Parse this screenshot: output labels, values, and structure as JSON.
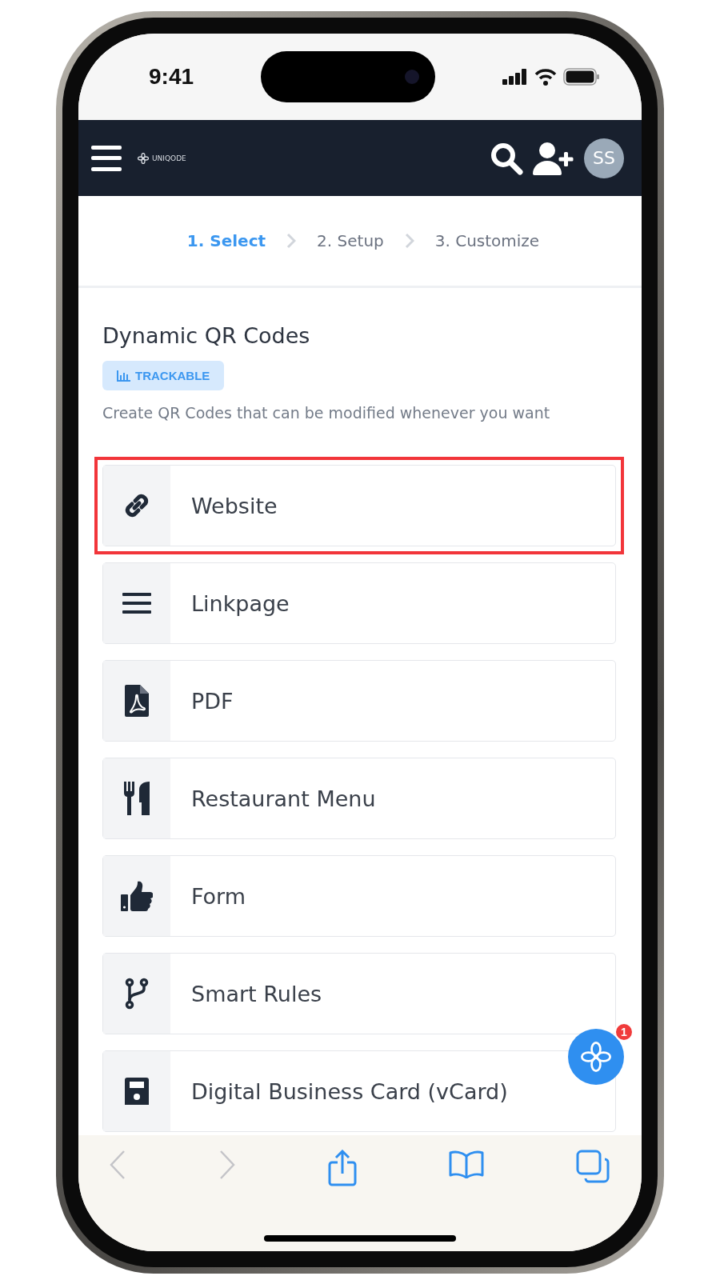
{
  "status_bar": {
    "time": "9:41"
  },
  "header": {
    "logo_text": "UNIQODE",
    "avatar": "SS"
  },
  "steps": [
    {
      "label": "1. Select",
      "selected": true
    },
    {
      "label": "2. Setup",
      "selected": false
    },
    {
      "label": "3. Customize",
      "selected": false
    }
  ],
  "section": {
    "title": "Dynamic QR Codes",
    "badge": "TRACKABLE",
    "description": "Create QR Codes that can be modified whenever you want"
  },
  "items": [
    {
      "kind": "link",
      "label": "Website",
      "selected": true
    },
    {
      "kind": "list",
      "label": "Linkpage",
      "selected": false
    },
    {
      "kind": "pdf",
      "label": "PDF",
      "selected": false
    },
    {
      "kind": "utensils",
      "label": "Restaurant Menu",
      "selected": false
    },
    {
      "kind": "thumb",
      "label": "Form",
      "selected": false
    },
    {
      "kind": "branch",
      "label": "Smart Rules",
      "selected": false
    },
    {
      "kind": "card",
      "label": "Digital Business Card (vCard)",
      "selected": false
    }
  ],
  "chat": {
    "badge": "1"
  },
  "browser_toolbar": [
    {
      "kind": "back",
      "disabled": true
    },
    {
      "kind": "forward",
      "disabled": true
    },
    {
      "kind": "share",
      "disabled": false
    },
    {
      "kind": "bookmarks",
      "disabled": false
    },
    {
      "kind": "tabs",
      "disabled": false
    }
  ]
}
